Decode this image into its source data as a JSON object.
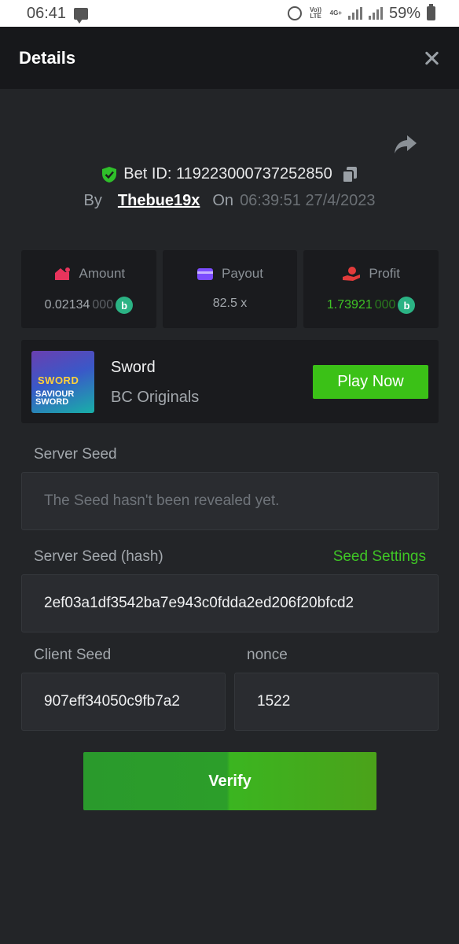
{
  "statusbar": {
    "time": "06:41",
    "network_top": "Vo)) LTE",
    "network_top2": "4G+",
    "battery": "59%"
  },
  "header": {
    "title": "Details"
  },
  "bet": {
    "id_label": "Bet ID: 119223000737252850",
    "by_label": "By",
    "user": "Thebue19x",
    "on_label": "On",
    "datetime": "06:39:51 27/4/2023"
  },
  "stats": {
    "amount": {
      "label": "Amount",
      "value_main": "0.02134",
      "value_dim": "000",
      "icon": "money-bag-icon",
      "color": "#e8345c"
    },
    "payout": {
      "label": "Payout",
      "value": "82.5 x",
      "icon": "wallet-icon",
      "color": "#7c4dff"
    },
    "profit": {
      "label": "Profit",
      "value_main": "1.73921",
      "value_dim": "000",
      "icon": "hand-coin-icon",
      "color": "#e23b3b"
    },
    "coin_letter": "b"
  },
  "game": {
    "thumb_title": "SWORD",
    "thumb_sub": "SAVIOUR SWORD",
    "name": "Sword",
    "provider": "BC Originals",
    "play_label": "Play Now"
  },
  "seeds": {
    "server_seed_label": "Server Seed",
    "server_seed_placeholder": "The Seed hasn't been revealed yet.",
    "server_hash_label": "Server Seed (hash)",
    "seed_settings_label": "Seed Settings",
    "server_hash_value": "2ef03a1df3542ba7e943c0fdda2ed206f20bfcd2",
    "client_seed_label": "Client Seed",
    "client_seed_value": "907eff34050c9fb7a2",
    "nonce_label": "nonce",
    "nonce_value": "1522"
  },
  "verify_label": "Verify",
  "colors": {
    "accent_green": "#3bc117",
    "background": "#232528",
    "card": "#1a1b1e"
  }
}
